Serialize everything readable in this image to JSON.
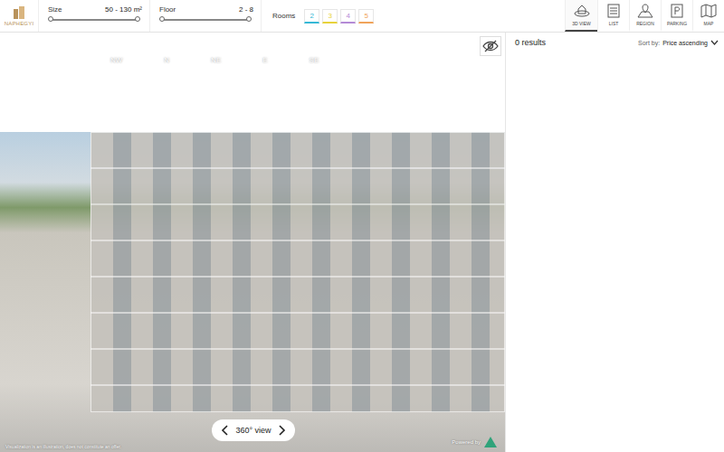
{
  "logo": {
    "name": "NAPHEGYI"
  },
  "filters": [
    {
      "label": "Size",
      "range": "50 - 130 m²",
      "level": 1
    },
    {
      "label": "Floor",
      "range": "2 - 8",
      "level": 1
    }
  ],
  "rooms": {
    "label": "Rooms",
    "options": [
      {
        "label": "2",
        "color": "#35b8d6",
        "selected": false
      },
      {
        "label": "3",
        "color": "#e8d23a",
        "selected": false
      },
      {
        "label": "4",
        "color": "#b48ad6",
        "selected": false
      },
      {
        "label": "5",
        "color": "#f0a35a",
        "selected": false
      }
    ]
  },
  "nav": [
    {
      "label": "3D VIEW",
      "selected": true
    },
    {
      "label": "LIST",
      "selected": false
    },
    {
      "label": "REGION",
      "selected": false
    },
    {
      "label": "PARKING",
      "selected": false
    },
    {
      "label": "MAP",
      "selected": false
    }
  ],
  "compass": [
    "NW",
    "N",
    "NE",
    "E",
    "SE"
  ],
  "view": {
    "toggle_label": "360° view",
    "disclaimer": "Visualization is an illustration, does not constitute an offer.",
    "powered_by": "Powered by"
  },
  "results": {
    "count": "0 results",
    "sort_label": "Sort by:",
    "sort_value": "Price ascending"
  }
}
